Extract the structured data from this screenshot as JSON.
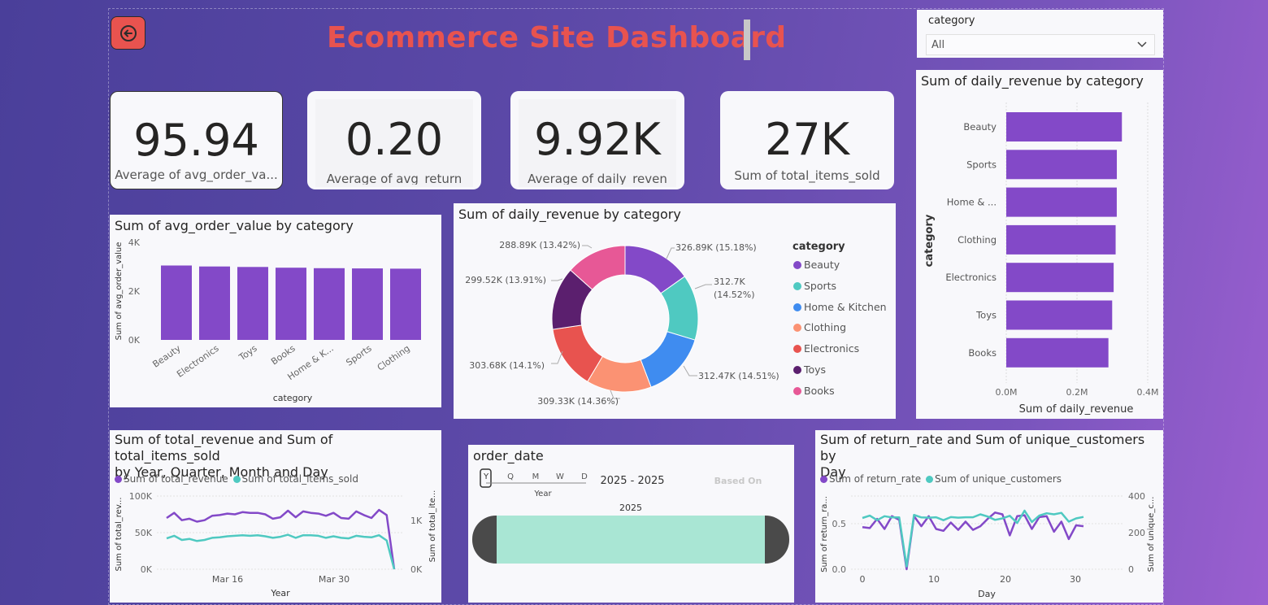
{
  "header": {
    "title": "Ecommerce Site Dashboard",
    "back_icon": "back-arrow-icon"
  },
  "colors": {
    "accent": "#e8534f",
    "purple": "#8349c8",
    "teal": "#4fc9c1",
    "slider": "#a9e6d4"
  },
  "slicer": {
    "label": "category",
    "selected": "All"
  },
  "kpis": [
    {
      "value": "95.94",
      "caption": "Average of avg_order_va..."
    },
    {
      "value": "0.20",
      "caption": "Average of avg_return"
    },
    {
      "value": "9.92K",
      "caption": "Average of daily_reven"
    },
    {
      "value": "27K",
      "caption": "Sum of total_items_sold"
    }
  ],
  "charts": {
    "avg_order": {
      "title": "Sum of avg_order_value by category",
      "xlabel": "category",
      "ylabel": "Sum of avg_order_value",
      "ticks": [
        "4K",
        "2K",
        "0K"
      ]
    },
    "donut": {
      "title": "Sum of daily_revenue by category",
      "legend_title": "category",
      "slice_labels": [
        "326.89K (15.18%)",
        "312.7K",
        "(14.52%)",
        "312.47K (14.51%)",
        "309.33K (14.36%)",
        "303.68K (14.1%)",
        "299.52K (13.91%)",
        "288.89K (13.42%)"
      ]
    },
    "bar_h": {
      "title": "Sum of daily_revenue by category",
      "xlabel": "Sum of daily_revenue",
      "ylabel": "category",
      "ticks": [
        "0.0M",
        "0.2M",
        "0.4M"
      ]
    },
    "line_total": {
      "title_l1": "Sum of total_revenue and Sum of total_items_sold",
      "title_l2": "by Year, Quarter, Month and Day",
      "legend": [
        "Sum of total_revenue",
        "Sum of total_items_sold"
      ],
      "xlabel": "Year",
      "ylabel_left": "Sum of total_rev...",
      "ylabel_right": "Sum of total_ite...",
      "left_ticks": [
        "100K",
        "50K",
        "0K"
      ],
      "right_ticks": [
        "1K",
        "0K"
      ],
      "x_ticks": [
        "Mar 16",
        "Mar 30"
      ]
    },
    "date_slicer": {
      "title": "order_date",
      "levels": [
        "Y",
        "Q",
        "M",
        "W",
        "D"
      ],
      "level_label": "Year",
      "range": "2025 - 2025",
      "based_on": "Based On",
      "bar_label": "2025"
    },
    "line_return": {
      "title_l1": "Sum of return_rate and Sum of unique_customers by",
      "title_l2": "Day",
      "legend": [
        "Sum of return_rate",
        "Sum of unique_customers"
      ],
      "xlabel": "Day",
      "ylabel_left": "Sum of return_ra...",
      "ylabel_right": "Sum of unique_c...",
      "left_ticks": [
        "0.5",
        "0.0"
      ],
      "right_ticks": [
        "400",
        "200",
        "0"
      ],
      "x_ticks": [
        "0",
        "10",
        "20",
        "30"
      ]
    }
  },
  "chart_data": [
    {
      "type": "bar",
      "title": "Sum of avg_order_value by category",
      "categories": [
        "Beauty",
        "Electronics",
        "Toys",
        "Books",
        "Home & K...",
        "Sports",
        "Clothing"
      ],
      "values": [
        3050,
        3010,
        2990,
        2960,
        2940,
        2930,
        2920
      ],
      "xlabel": "category",
      "ylabel": "Sum of avg_order_value",
      "ylim": [
        0,
        4000
      ]
    },
    {
      "type": "pie",
      "title": "Sum of daily_revenue by category",
      "categories": [
        "Beauty",
        "Sports",
        "Home & Kitchen",
        "Clothing",
        "Electronics",
        "Toys",
        "Books"
      ],
      "values": [
        326.89,
        312.7,
        312.47,
        309.33,
        303.68,
        299.52,
        288.89
      ],
      "percent": [
        15.18,
        14.52,
        14.51,
        14.36,
        14.1,
        13.91,
        13.42
      ],
      "colors": [
        "#8349c8",
        "#4fc9c1",
        "#3f8cf0",
        "#fb9273",
        "#e8534f",
        "#5b1f6e",
        "#e75896"
      ],
      "unit": "K"
    },
    {
      "type": "bar",
      "title": "Sum of daily_revenue by category",
      "categories": [
        "Beauty",
        "Sports",
        "Home & ...",
        "Clothing",
        "Electronics",
        "Toys",
        "Books"
      ],
      "values": [
        0.327,
        0.3127,
        0.3125,
        0.3093,
        0.3037,
        0.2995,
        0.2889
      ],
      "xlabel": "Sum of daily_revenue",
      "ylabel": "category",
      "xlim": [
        0,
        0.4
      ],
      "unit": "M"
    },
    {
      "type": "line",
      "title": "Sum of total_revenue and Sum of total_items_sold by Year, Quarter, Month and Day",
      "series": [
        {
          "name": "Sum of total_revenue",
          "values": [
            70000,
            77000,
            67000,
            69000,
            65000,
            67000,
            73000,
            74000,
            76000,
            75000,
            78000,
            77000,
            77000,
            75000,
            69000,
            71000,
            80000,
            71000,
            79000,
            77000,
            76000,
            73000,
            77000,
            70000,
            69000,
            79000,
            74000,
            70000,
            81000,
            74000,
            0
          ]
        },
        {
          "name": "Sum of total_items_sold",
          "values": [
            590,
            640,
            560,
            580,
            540,
            560,
            600,
            610,
            630,
            640,
            650,
            640,
            650,
            630,
            600,
            620,
            660,
            600,
            650,
            650,
            640,
            600,
            630,
            600,
            590,
            640,
            620,
            610,
            650,
            550,
            0
          ]
        }
      ],
      "xlabel": "Year",
      "ylim_left": [
        0,
        100000
      ],
      "ylim_right": [
        0,
        1400
      ]
    },
    {
      "type": "line",
      "title": "Sum of return_rate and Sum of unique_customers by Day",
      "x": [
        1,
        2,
        3,
        4,
        5,
        6,
        7,
        8,
        9,
        10,
        11,
        12,
        13,
        14,
        15,
        16,
        17,
        18,
        19,
        20,
        21,
        22,
        23,
        24,
        25,
        26,
        27,
        28,
        29,
        30,
        31
      ],
      "series": [
        {
          "name": "Sum of return_rate",
          "values": [
            0.46,
            0.45,
            0.55,
            0.44,
            0.58,
            0.54,
            0.0,
            0.58,
            0.47,
            0.58,
            0.44,
            0.42,
            0.51,
            0.43,
            0.52,
            0.43,
            0.47,
            0.55,
            0.62,
            0.6,
            0.37,
            0.58,
            0.59,
            0.44,
            0.57,
            0.58,
            0.41,
            0.52,
            0.33,
            0.48,
            0.47
          ]
        },
        {
          "name": "Sum of unique_customers",
          "values": [
            280,
            293,
            268,
            290,
            283,
            283,
            15,
            297,
            283,
            282,
            284,
            268,
            285,
            282,
            284,
            284,
            300,
            288,
            270,
            278,
            292,
            253,
            320,
            258,
            293,
            306,
            300,
            308,
            260,
            278,
            286
          ]
        }
      ],
      "xlabel": "Day",
      "ylim_left": [
        0,
        0.8
      ],
      "ylim_right": [
        0,
        400
      ]
    }
  ]
}
